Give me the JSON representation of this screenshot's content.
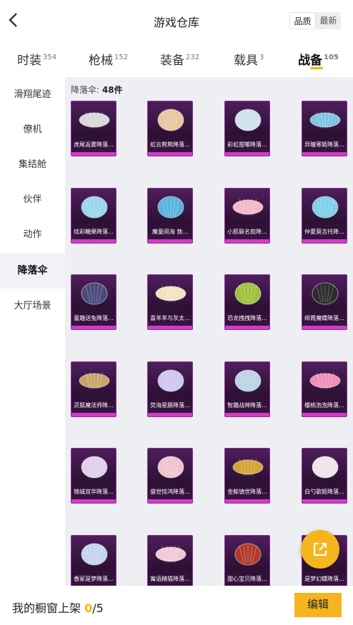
{
  "header": {
    "title": "游戏仓库",
    "sort_quality": "品质",
    "sort_latest": "最新"
  },
  "tabs": [
    {
      "label": "时装",
      "count": "354"
    },
    {
      "label": "枪械",
      "count": "152"
    },
    {
      "label": "装备",
      "count": "232"
    },
    {
      "label": "载具",
      "count": "3"
    },
    {
      "label": "战备",
      "count": "105"
    }
  ],
  "sidebar": {
    "items": [
      {
        "label": "滑翔尾迹"
      },
      {
        "label": "僚机"
      },
      {
        "label": "集结舱"
      },
      {
        "label": "伙伴"
      },
      {
        "label": "动作"
      },
      {
        "label": "降落伞"
      },
      {
        "label": "大厅场景"
      }
    ]
  },
  "content": {
    "count_label": "降落伞:",
    "count_value": "48件"
  },
  "items": [
    {
      "name": "虎尾返雾降落...",
      "color": "#d8d8d8"
    },
    {
      "name": "虹云熊熊降落...",
      "color": "#e8c7a0"
    },
    {
      "name": "彩虹甜嘟降落...",
      "color": "#cfe2ef"
    },
    {
      "name": "异瞳寒姬降落...",
      "color": "#7fc4e0"
    },
    {
      "name": "炫彩糖果降落...",
      "color": "#9ad6ee"
    },
    {
      "name": "魔童闹海 敖...",
      "color": "#5ab3de"
    },
    {
      "name": "小肌联名款降...",
      "color": "#f3b8c6"
    },
    {
      "name": "仲夏莫吉托降...",
      "color": "#7fd0e8"
    },
    {
      "name": "童趣送兔降落...",
      "color": "#4a4a7a"
    },
    {
      "name": "喜羊羊与灰太...",
      "color": "#f2e3c2"
    },
    {
      "name": "恐龙拽拽降落...",
      "color": "#9ec23e"
    },
    {
      "name": "绯霞魔蝶降落...",
      "color": "#2c2c2c"
    },
    {
      "name": "灵狐魔法师降...",
      "color": "#c9a46a"
    },
    {
      "name": "荧海星豚降落...",
      "color": "#cfc6f0"
    },
    {
      "name": "智趣战神降落...",
      "color": "#bcd3e6"
    },
    {
      "name": "樱桃泡泡降落...",
      "color": "#ef8fb6"
    },
    {
      "name": "锦城双华降落...",
      "color": "#e0d0ea"
    },
    {
      "name": "盛世惊鸿降落...",
      "color": "#f1c3cf"
    },
    {
      "name": "金鲸镇世降落...",
      "color": "#d3a536"
    },
    {
      "name": "白勺歌姬降落...",
      "color": "#f0e4ec"
    },
    {
      "name": "香冢是梦降落...",
      "color": "#c7d4f0"
    },
    {
      "name": "寓语精猫降落...",
      "color": "#f2c8d8"
    },
    {
      "name": "甜心宝贝降落...",
      "color": "#b23a2a"
    },
    {
      "name": "是梦幻蝶降落...",
      "color": "#d9a0c8"
    }
  ],
  "footer": {
    "label": "我的橱窗上架 ",
    "current": "0",
    "total": "/5",
    "edit_label": "编辑"
  }
}
